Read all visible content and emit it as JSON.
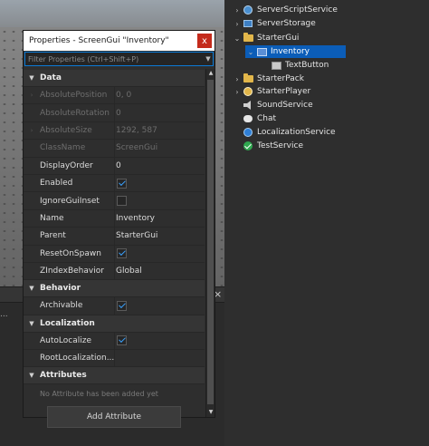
{
  "explorer": {
    "items": [
      {
        "label": "ServerScriptService",
        "icon": "script-service-icon",
        "arrow": "›",
        "selected": false
      },
      {
        "label": "ServerStorage",
        "icon": "storage-icon",
        "arrow": "›",
        "selected": false
      },
      {
        "label": "StarterGui",
        "icon": "folder-icon",
        "arrow": "⌄",
        "selected": false
      },
      {
        "label": "Inventory",
        "icon": "screengui-icon",
        "arrow": "⌄",
        "selected": true
      },
      {
        "label": "TextButton",
        "icon": "textbutton-icon",
        "arrow": "",
        "selected": false
      },
      {
        "label": "StarterPack",
        "icon": "folder-icon",
        "arrow": "›",
        "selected": false
      },
      {
        "label": "StarterPlayer",
        "icon": "player-icon",
        "arrow": "›",
        "selected": false
      },
      {
        "label": "SoundService",
        "icon": "sound-icon",
        "arrow": "",
        "selected": false
      },
      {
        "label": "Chat",
        "icon": "chat-icon",
        "arrow": "",
        "selected": false
      },
      {
        "label": "LocalizationService",
        "icon": "localization-icon",
        "arrow": "",
        "selected": false
      },
      {
        "label": "TestService",
        "icon": "test-icon",
        "arrow": "",
        "selected": false
      }
    ]
  },
  "properties": {
    "title": "Properties - ScreenGui \"Inventory\"",
    "close_label": "x",
    "filter_placeholder": "Filter Properties (Ctrl+Shift+P)",
    "sections": {
      "data": "Data",
      "behavior": "Behavior",
      "localization": "Localization",
      "attributes": "Attributes"
    },
    "data_rows": [
      {
        "name": "AbsolutePosition",
        "value": "0, 0",
        "dim": true,
        "expandable": true
      },
      {
        "name": "AbsoluteRotation",
        "value": "0",
        "dim": true
      },
      {
        "name": "AbsoluteSize",
        "value": "1292, 587",
        "dim": true,
        "expandable": true
      },
      {
        "name": "ClassName",
        "value": "ScreenGui",
        "dim": true
      },
      {
        "name": "DisplayOrder",
        "value": "0"
      },
      {
        "name": "Enabled",
        "checkbox": true,
        "checked": true
      },
      {
        "name": "IgnoreGuiInset",
        "checkbox": true,
        "checked": false
      },
      {
        "name": "Name",
        "value": "Inventory"
      },
      {
        "name": "Parent",
        "value": "StarterGui"
      },
      {
        "name": "ResetOnSpawn",
        "checkbox": true,
        "checked": true
      },
      {
        "name": "ZIndexBehavior",
        "value": "Global"
      }
    ],
    "behavior_rows": [
      {
        "name": "Archivable",
        "checkbox": true,
        "checked": true
      }
    ],
    "localization_rows": [
      {
        "name": "AutoLocalize",
        "checkbox": true,
        "checked": true
      },
      {
        "name": "RootLocalization...",
        "value": ""
      }
    ],
    "attributes_empty": "No Attribute has been added yet",
    "add_attribute_label": "Add Attribute"
  },
  "lower_panel": {
    "close_label": "×",
    "ellipsis": "..."
  }
}
